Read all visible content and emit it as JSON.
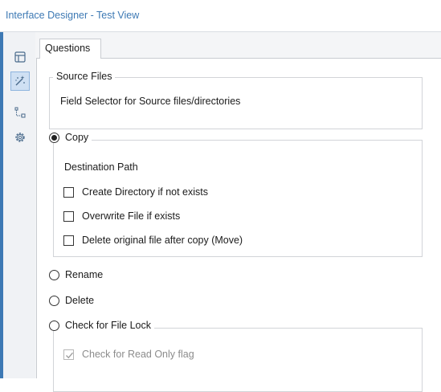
{
  "window": {
    "title": "Interface Designer - Test View"
  },
  "toolbar": {
    "tools": [
      {
        "icon": "layout-icon",
        "active": false
      },
      {
        "icon": "magic-wand-icon",
        "active": true
      },
      {
        "icon": "tree-connector-icon",
        "active": false
      },
      {
        "icon": "gear-icon",
        "active": false
      }
    ]
  },
  "tabs": [
    {
      "label": "Questions",
      "selected": true
    }
  ],
  "source_files": {
    "legend": "Source Files",
    "description": "Field Selector for Source files/directories"
  },
  "copy_group": {
    "label": "Copy",
    "selected": true,
    "destination_label": "Destination Path",
    "options": [
      {
        "label": "Create Directory if not exists",
        "checked": false
      },
      {
        "label": "Overwrite File if exists",
        "checked": false
      },
      {
        "label": "Delete original file after copy (Move)",
        "checked": false
      }
    ]
  },
  "rename": {
    "label": "Rename",
    "selected": false
  },
  "delete": {
    "label": "Delete",
    "selected": false
  },
  "lock_group": {
    "label": "Check for File Lock",
    "selected": false,
    "options": [
      {
        "label": "Check for Read Only flag",
        "checked": true,
        "disabled": true
      }
    ]
  }
}
